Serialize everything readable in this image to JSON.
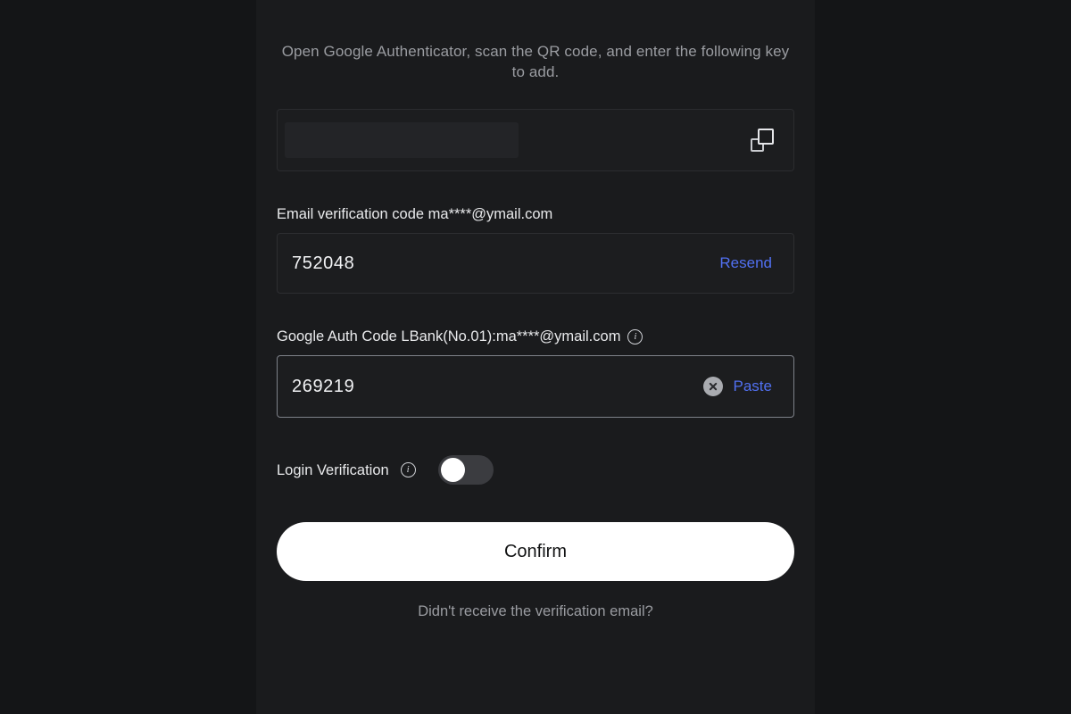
{
  "colors": {
    "page_background": "#141517",
    "panel_background": "#1a1b1d",
    "field_background": "#1c1d1f",
    "link_accent": "#5170f1",
    "confirm_background": "#ffffff",
    "toggle_track_off": "#3b3c40",
    "toggle_knob": "#ffffff"
  },
  "instructions": {
    "text": "Open Google Authenticator, scan the QR code, and enter the following key to add."
  },
  "secret_key_box": {
    "value": "",
    "redacted": true,
    "copy_icon": "copy-icon"
  },
  "email_field": {
    "label": "Email verification code ma****@ymail.com",
    "value": "752048",
    "placeholder": "Email verification code",
    "action_label": "Resend"
  },
  "google_auth_field": {
    "label": "Google Auth Code LBank(No.01):ma****@ymail.com",
    "info_icon": "info-icon",
    "value": "269219",
    "placeholder": "Google Auth Code",
    "clear_icon": "clear-icon",
    "action_label": "Paste",
    "focused": true
  },
  "login_verification": {
    "label": "Login Verification",
    "info_icon": "info-icon",
    "enabled": false,
    "state_text": "off"
  },
  "confirm": {
    "label": "Confirm"
  },
  "footer": {
    "link_label": "Didn't receive the verification email?"
  }
}
